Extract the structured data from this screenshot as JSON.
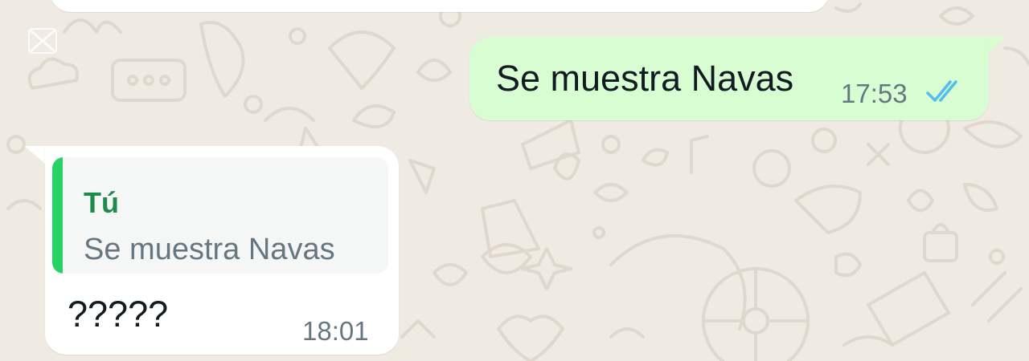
{
  "conversation": {
    "outgoing_message": {
      "text": "Se muestra Navas",
      "time": "17:53",
      "status_icon": "double-check-icon",
      "status_color": "#53bdeb"
    },
    "incoming_message": {
      "quoted_author": "Tú",
      "quoted_text": "Se muestra Navas",
      "text": "?????",
      "time": "18:01"
    }
  },
  "colors": {
    "background": "#efeae2",
    "outgoing_bubble": "#d9fdd3",
    "incoming_bubble": "#ffffff",
    "quote_accent": "#25d366",
    "quote_author": "#1f8c4b"
  }
}
